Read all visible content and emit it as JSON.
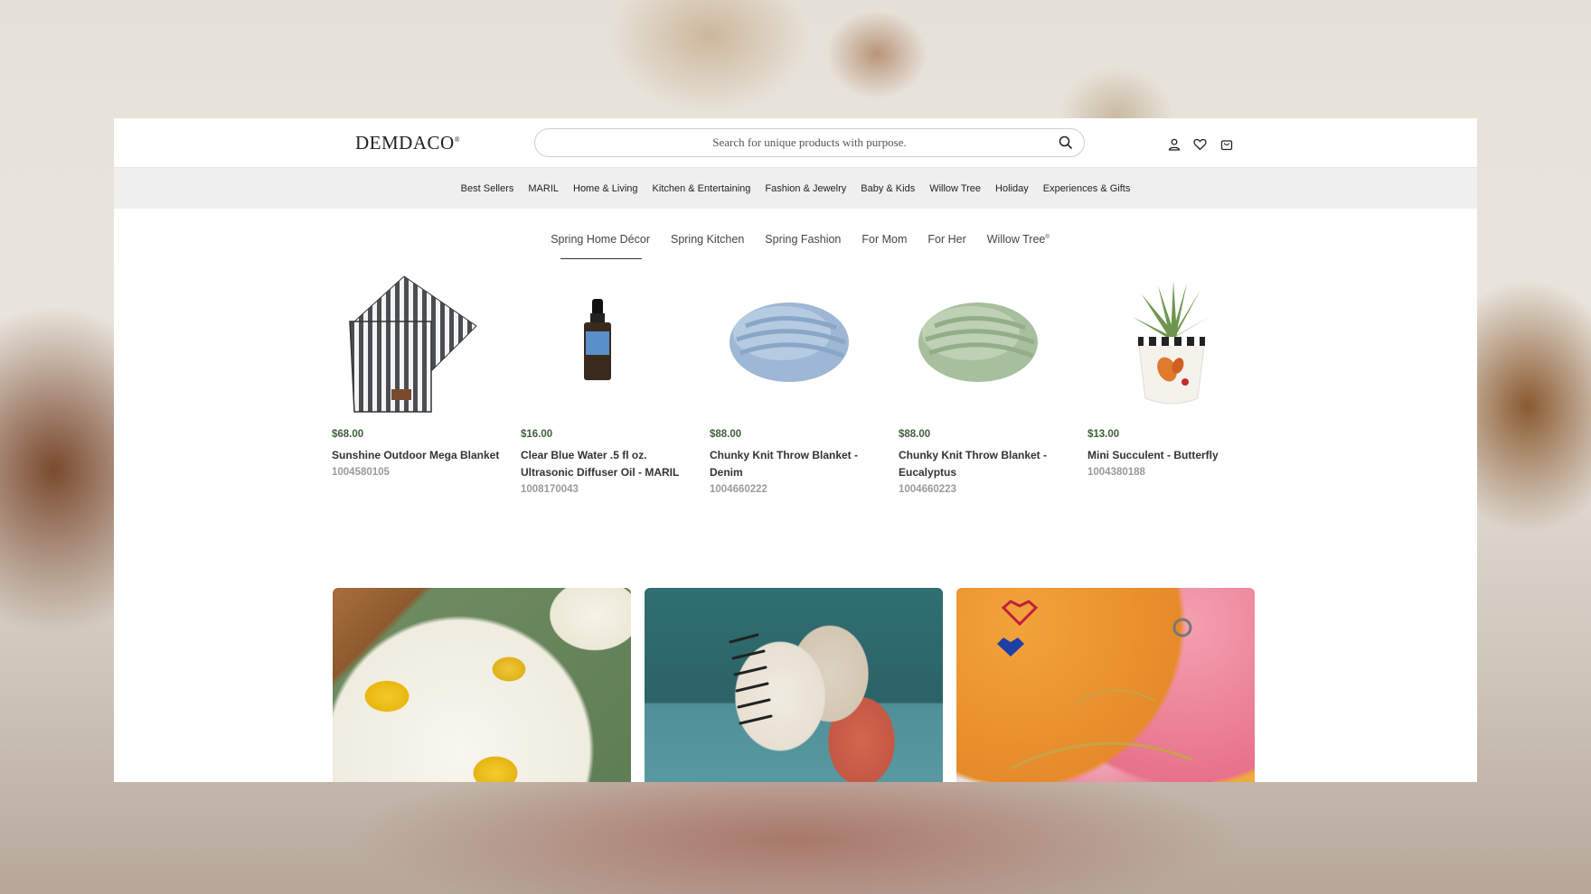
{
  "header": {
    "logo": "DEMDACO",
    "logo_mark": "®",
    "search_placeholder": "Search for unique products with purpose."
  },
  "categories": [
    "Best Sellers",
    "MARIL",
    "Home & Living",
    "Kitchen & Entertaining",
    "Fashion & Jewelry",
    "Baby & Kids",
    "Willow Tree",
    "Holiday",
    "Experiences & Gifts"
  ],
  "tabs": {
    "active": "Spring Home Décor",
    "items": [
      "Spring Home Décor",
      "Spring Kitchen",
      "Spring Fashion",
      "For Mom",
      "For Her",
      "Willow Tree"
    ],
    "willow_mark": "®"
  },
  "products": [
    {
      "price": "$68.00",
      "name": "Sunshine Outdoor Mega Blanket",
      "sku": "1004580105",
      "icon": "striped-blanket-image"
    },
    {
      "price": "$16.00",
      "name": "Clear Blue Water .5 fl oz. Ultrasonic Diffuser Oil - MARIL",
      "sku": "1008170043",
      "icon": "diffuser-oil-bottle-image"
    },
    {
      "price": "$88.00",
      "name": "Chunky Knit Throw Blanket - Denim",
      "sku": "1004660222",
      "icon": "denim-knit-blanket-image"
    },
    {
      "price": "$88.00",
      "name": "Chunky Knit Throw Blanket - Eucalyptus",
      "sku": "1004660223",
      "icon": "eucalyptus-knit-blanket-image"
    },
    {
      "price": "$13.00",
      "name": "Mini Succulent - Butterfly",
      "sku": "1004380188",
      "icon": "succulent-pot-image"
    }
  ],
  "banners": [
    {
      "icon": "lemon-plates-image"
    },
    {
      "icon": "sofa-pillows-image"
    },
    {
      "icon": "jewelry-plates-image"
    }
  ],
  "colors": {
    "price": "#3f5f3b",
    "nav_bg": "#efefef",
    "sku": "#9a9a9a"
  }
}
